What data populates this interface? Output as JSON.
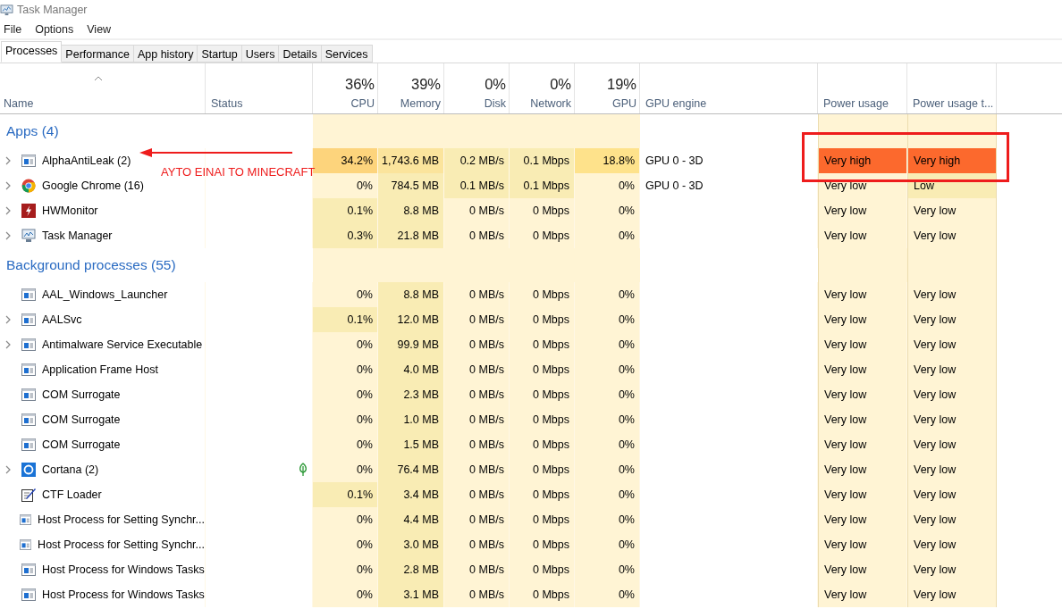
{
  "window": {
    "title": "Task Manager"
  },
  "menu": [
    "File",
    "Options",
    "View"
  ],
  "tabs": [
    {
      "label": "Processes",
      "selected": true
    },
    {
      "label": "Performance",
      "selected": false
    },
    {
      "label": "App history",
      "selected": false
    },
    {
      "label": "Startup",
      "selected": false
    },
    {
      "label": "Users",
      "selected": false
    },
    {
      "label": "Details",
      "selected": false
    },
    {
      "label": "Services",
      "selected": false
    }
  ],
  "columns": [
    {
      "label": "Name",
      "kind": "name",
      "sorted": true
    },
    {
      "label": "Status",
      "kind": "text",
      "sorted": false
    },
    {
      "label": "CPU",
      "total": "36%",
      "kind": "metric",
      "sorted": false
    },
    {
      "label": "Memory",
      "total": "39%",
      "kind": "metric",
      "sorted": false
    },
    {
      "label": "Disk",
      "total": "0%",
      "kind": "metric",
      "sorted": false
    },
    {
      "label": "Network",
      "total": "0%",
      "kind": "metric",
      "sorted": false
    },
    {
      "label": "GPU",
      "total": "19%",
      "kind": "metric",
      "sorted": false
    },
    {
      "label": "GPU engine",
      "kind": "text",
      "sorted": false
    },
    {
      "label": "Power usage",
      "kind": "text",
      "sorted": false
    },
    {
      "label": "Power usage t...",
      "kind": "text",
      "sorted": false
    }
  ],
  "groups": [
    {
      "title": "Apps (4)",
      "rows": [
        {
          "name": "AlphaAntiLeak (2)",
          "kind": "window",
          "expandable": true,
          "cpu": {
            "text": "34.2%",
            "color": "#fdd47c"
          },
          "memory": {
            "text": "1,743.6 MB",
            "color": "#fbe49c"
          },
          "disk": {
            "text": "0.2 MB/s",
            "color": "#f9ecb4"
          },
          "network": {
            "text": "0.1 Mbps",
            "color": "#f9ecb4"
          },
          "gpu": {
            "text": "18.8%",
            "color": "#fee28b"
          },
          "gpu_engine": "GPU 0 - 3D",
          "power": {
            "text": "Very high",
            "color": "#fc692d"
          },
          "power_trend": {
            "text": "Very high",
            "color": "#fc692d"
          }
        },
        {
          "name": "Google Chrome (16)",
          "kind": "browser",
          "expandable": true,
          "cpu": {
            "text": "0%",
            "color": "#fff4d4"
          },
          "memory": {
            "text": "784.5 MB",
            "color": "#f9ecb4"
          },
          "disk": {
            "text": "0.1 MB/s",
            "color": "#f9ecb4"
          },
          "network": {
            "text": "0.1 Mbps",
            "color": "#f9ecb4"
          },
          "gpu": {
            "text": "0%",
            "color": "#fff4d4"
          },
          "gpu_engine": "GPU 0 - 3D",
          "power": {
            "text": "Very low",
            "color": "#fff4d4"
          },
          "power_trend": {
            "text": "Low",
            "color": "#f9ecb4"
          }
        },
        {
          "name": "HWMonitor",
          "kind": "hardware",
          "expandable": true,
          "cpu": {
            "text": "0.1%",
            "color": "#f9ecb4"
          },
          "memory": {
            "text": "8.8 MB",
            "color": "#f9ecb4"
          },
          "disk": {
            "text": "0 MB/s",
            "color": "#fff4d4"
          },
          "network": {
            "text": "0 Mbps",
            "color": "#fff4d4"
          },
          "gpu": {
            "text": "0%",
            "color": "#fff4d4"
          },
          "power": {
            "text": "Very low",
            "color": "#fff4d4"
          },
          "power_trend": {
            "text": "Very low",
            "color": "#fff4d4"
          }
        },
        {
          "name": "Task Manager",
          "kind": "monitor",
          "expandable": true,
          "cpu": {
            "text": "0.3%",
            "color": "#f9ecb4"
          },
          "memory": {
            "text": "21.8 MB",
            "color": "#f9ecb4"
          },
          "disk": {
            "text": "0 MB/s",
            "color": "#fff4d4"
          },
          "network": {
            "text": "0 Mbps",
            "color": "#fff4d4"
          },
          "gpu": {
            "text": "0%",
            "color": "#fff4d4"
          },
          "power": {
            "text": "Very low",
            "color": "#fff4d4"
          },
          "power_trend": {
            "text": "Very low",
            "color": "#fff4d4"
          }
        }
      ]
    },
    {
      "title": "Background processes (55)",
      "rows": [
        {
          "name": "AAL_Windows_Launcher",
          "kind": "window",
          "expandable": false,
          "cpu": {
            "text": "0%",
            "color": "#fff4d4"
          },
          "memory": {
            "text": "8.8 MB",
            "color": "#f9ecb4"
          },
          "disk": {
            "text": "0 MB/s",
            "color": "#fff4d4"
          },
          "network": {
            "text": "0 Mbps",
            "color": "#fff4d4"
          },
          "gpu": {
            "text": "0%",
            "color": "#fff4d4"
          },
          "power": {
            "text": "Very low",
            "color": "#fff4d4"
          },
          "power_trend": {
            "text": "Very low",
            "color": "#fff4d4"
          }
        },
        {
          "name": "AALSvc",
          "kind": "window",
          "expandable": true,
          "cpu": {
            "text": "0.1%",
            "color": "#f9ecb4"
          },
          "memory": {
            "text": "12.0 MB",
            "color": "#f9ecb4"
          },
          "disk": {
            "text": "0 MB/s",
            "color": "#fff4d4"
          },
          "network": {
            "text": "0 Mbps",
            "color": "#fff4d4"
          },
          "gpu": {
            "text": "0%",
            "color": "#fff4d4"
          },
          "power": {
            "text": "Very low",
            "color": "#fff4d4"
          },
          "power_trend": {
            "text": "Very low",
            "color": "#fff4d4"
          }
        },
        {
          "name": "Antimalware Service Executable",
          "kind": "window",
          "expandable": true,
          "cpu": {
            "text": "0%",
            "color": "#fff4d4"
          },
          "memory": {
            "text": "99.9 MB",
            "color": "#f9ecb4"
          },
          "disk": {
            "text": "0 MB/s",
            "color": "#fff4d4"
          },
          "network": {
            "text": "0 Mbps",
            "color": "#fff4d4"
          },
          "gpu": {
            "text": "0%",
            "color": "#fff4d4"
          },
          "power": {
            "text": "Very low",
            "color": "#fff4d4"
          },
          "power_trend": {
            "text": "Very low",
            "color": "#fff4d4"
          }
        },
        {
          "name": "Application Frame Host",
          "kind": "window",
          "expandable": false,
          "cpu": {
            "text": "0%",
            "color": "#fff4d4"
          },
          "memory": {
            "text": "4.0 MB",
            "color": "#f9ecb4"
          },
          "disk": {
            "text": "0 MB/s",
            "color": "#fff4d4"
          },
          "network": {
            "text": "0 Mbps",
            "color": "#fff4d4"
          },
          "gpu": {
            "text": "0%",
            "color": "#fff4d4"
          },
          "power": {
            "text": "Very low",
            "color": "#fff4d4"
          },
          "power_trend": {
            "text": "Very low",
            "color": "#fff4d4"
          }
        },
        {
          "name": "COM Surrogate",
          "kind": "window",
          "expandable": false,
          "cpu": {
            "text": "0%",
            "color": "#fff4d4"
          },
          "memory": {
            "text": "2.3 MB",
            "color": "#f9ecb4"
          },
          "disk": {
            "text": "0 MB/s",
            "color": "#fff4d4"
          },
          "network": {
            "text": "0 Mbps",
            "color": "#fff4d4"
          },
          "gpu": {
            "text": "0%",
            "color": "#fff4d4"
          },
          "power": {
            "text": "Very low",
            "color": "#fff4d4"
          },
          "power_trend": {
            "text": "Very low",
            "color": "#fff4d4"
          }
        },
        {
          "name": "COM Surrogate",
          "kind": "window",
          "expandable": false,
          "cpu": {
            "text": "0%",
            "color": "#fff4d4"
          },
          "memory": {
            "text": "1.0 MB",
            "color": "#f9ecb4"
          },
          "disk": {
            "text": "0 MB/s",
            "color": "#fff4d4"
          },
          "network": {
            "text": "0 Mbps",
            "color": "#fff4d4"
          },
          "gpu": {
            "text": "0%",
            "color": "#fff4d4"
          },
          "power": {
            "text": "Very low",
            "color": "#fff4d4"
          },
          "power_trend": {
            "text": "Very low",
            "color": "#fff4d4"
          }
        },
        {
          "name": "COM Surrogate",
          "kind": "window",
          "expandable": false,
          "cpu": {
            "text": "0%",
            "color": "#fff4d4"
          },
          "memory": {
            "text": "1.5 MB",
            "color": "#f9ecb4"
          },
          "disk": {
            "text": "0 MB/s",
            "color": "#fff4d4"
          },
          "network": {
            "text": "0 Mbps",
            "color": "#fff4d4"
          },
          "gpu": {
            "text": "0%",
            "color": "#fff4d4"
          },
          "power": {
            "text": "Very low",
            "color": "#fff4d4"
          },
          "power_trend": {
            "text": "Very low",
            "color": "#fff4d4"
          }
        },
        {
          "name": "Cortana (2)",
          "kind": "assistant",
          "expandable": true,
          "eco_mode": true,
          "cpu": {
            "text": "0%",
            "color": "#fff4d4"
          },
          "memory": {
            "text": "76.4 MB",
            "color": "#f9ecb4"
          },
          "disk": {
            "text": "0 MB/s",
            "color": "#fff4d4"
          },
          "network": {
            "text": "0 Mbps",
            "color": "#fff4d4"
          },
          "gpu": {
            "text": "0%",
            "color": "#fff4d4"
          },
          "power": {
            "text": "Very low",
            "color": "#fff4d4"
          },
          "power_trend": {
            "text": "Very low",
            "color": "#fff4d4"
          }
        },
        {
          "name": "CTF Loader",
          "kind": "loader",
          "expandable": false,
          "cpu": {
            "text": "0.1%",
            "color": "#f9ecb4"
          },
          "memory": {
            "text": "3.4 MB",
            "color": "#f9ecb4"
          },
          "disk": {
            "text": "0 MB/s",
            "color": "#fff4d4"
          },
          "network": {
            "text": "0 Mbps",
            "color": "#fff4d4"
          },
          "gpu": {
            "text": "0%",
            "color": "#fff4d4"
          },
          "power": {
            "text": "Very low",
            "color": "#fff4d4"
          },
          "power_trend": {
            "text": "Very low",
            "color": "#fff4d4"
          }
        },
        {
          "name": "Host Process for Setting Synchr...",
          "kind": "window",
          "expandable": false,
          "cpu": {
            "text": "0%",
            "color": "#fff4d4"
          },
          "memory": {
            "text": "4.4 MB",
            "color": "#f9ecb4"
          },
          "disk": {
            "text": "0 MB/s",
            "color": "#fff4d4"
          },
          "network": {
            "text": "0 Mbps",
            "color": "#fff4d4"
          },
          "gpu": {
            "text": "0%",
            "color": "#fff4d4"
          },
          "power": {
            "text": "Very low",
            "color": "#fff4d4"
          },
          "power_trend": {
            "text": "Very low",
            "color": "#fff4d4"
          }
        },
        {
          "name": "Host Process for Setting Synchr...",
          "kind": "window",
          "expandable": false,
          "cpu": {
            "text": "0%",
            "color": "#fff4d4"
          },
          "memory": {
            "text": "3.0 MB",
            "color": "#f9ecb4"
          },
          "disk": {
            "text": "0 MB/s",
            "color": "#fff4d4"
          },
          "network": {
            "text": "0 Mbps",
            "color": "#fff4d4"
          },
          "gpu": {
            "text": "0%",
            "color": "#fff4d4"
          },
          "power": {
            "text": "Very low",
            "color": "#fff4d4"
          },
          "power_trend": {
            "text": "Very low",
            "color": "#fff4d4"
          }
        },
        {
          "name": "Host Process for Windows Tasks",
          "kind": "window",
          "expandable": false,
          "cpu": {
            "text": "0%",
            "color": "#fff4d4"
          },
          "memory": {
            "text": "2.8 MB",
            "color": "#f9ecb4"
          },
          "disk": {
            "text": "0 MB/s",
            "color": "#fff4d4"
          },
          "network": {
            "text": "0 Mbps",
            "color": "#fff4d4"
          },
          "gpu": {
            "text": "0%",
            "color": "#fff4d4"
          },
          "power": {
            "text": "Very low",
            "color": "#fff4d4"
          },
          "power_trend": {
            "text": "Very low",
            "color": "#fff4d4"
          }
        },
        {
          "name": "Host Process for Windows Tasks",
          "kind": "window",
          "expandable": false,
          "cpu": {
            "text": "0%",
            "color": "#fff4d4"
          },
          "memory": {
            "text": "3.1 MB",
            "color": "#f9ecb4"
          },
          "disk": {
            "text": "0 MB/s",
            "color": "#fff4d4"
          },
          "network": {
            "text": "0 Mbps",
            "color": "#fff4d4"
          },
          "gpu": {
            "text": "0%",
            "color": "#fff4d4"
          },
          "power": {
            "text": "Very low",
            "color": "#fff4d4"
          },
          "power_trend": {
            "text": "Very low",
            "color": "#fff4d4"
          }
        }
      ]
    }
  ],
  "annotation": {
    "text": "AYTO EINAI TO MINECRAFT"
  }
}
